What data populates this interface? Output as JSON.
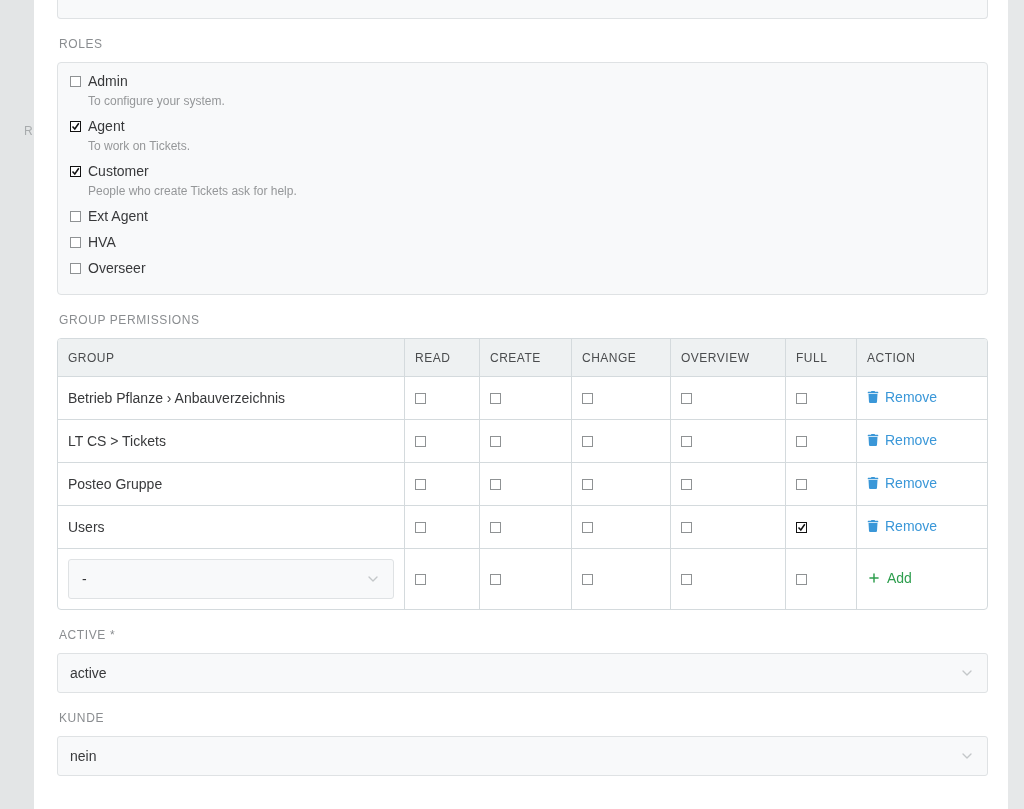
{
  "background_page": {
    "label_fragment": "R"
  },
  "roles": {
    "label": "ROLES",
    "items": [
      {
        "name": "Admin",
        "description": "To configure your system.",
        "checked": false
      },
      {
        "name": "Agent",
        "description": "To work on Tickets.",
        "checked": true
      },
      {
        "name": "Customer",
        "description": "People who create Tickets ask for help.",
        "checked": true
      },
      {
        "name": "Ext Agent",
        "checked": false
      },
      {
        "name": "HVA",
        "checked": false
      },
      {
        "name": "Overseer",
        "checked": false
      }
    ]
  },
  "group_permissions": {
    "label": "GROUP PERMISSIONS",
    "columns": [
      "GROUP",
      "READ",
      "CREATE",
      "CHANGE",
      "OVERVIEW",
      "FULL",
      "ACTION"
    ],
    "rows": [
      {
        "group": "Betrieb Pflanze › Anbauverzeichnis",
        "permissions": [
          {
            "checked": false
          },
          {
            "checked": false
          },
          {
            "checked": false
          },
          {
            "checked": false
          },
          {
            "checked": false
          }
        ],
        "action": "Remove"
      },
      {
        "group": "LT CS > Tickets",
        "permissions": [
          {
            "checked": false
          },
          {
            "checked": false
          },
          {
            "checked": false
          },
          {
            "checked": false
          },
          {
            "checked": false
          }
        ],
        "action": "Remove"
      },
      {
        "group": "Posteo Gruppe",
        "permissions": [
          {
            "checked": false
          },
          {
            "checked": false
          },
          {
            "checked": false
          },
          {
            "checked": false
          },
          {
            "checked": false
          }
        ],
        "action": "Remove"
      },
      {
        "group": "Users",
        "permissions": [
          {
            "checked": false
          },
          {
            "checked": false
          },
          {
            "checked": false
          },
          {
            "checked": false
          },
          {
            "checked": true
          }
        ],
        "action": "Remove"
      }
    ],
    "new_row": {
      "group_select": "-",
      "permissions": [
        {
          "checked": false
        },
        {
          "checked": false
        },
        {
          "checked": false
        },
        {
          "checked": false
        },
        {
          "checked": false
        }
      ],
      "action": "Add"
    }
  },
  "fields": [
    {
      "label": "ACTIVE *",
      "value": "active"
    },
    {
      "label": "KUNDE",
      "value": "nein"
    }
  ]
}
